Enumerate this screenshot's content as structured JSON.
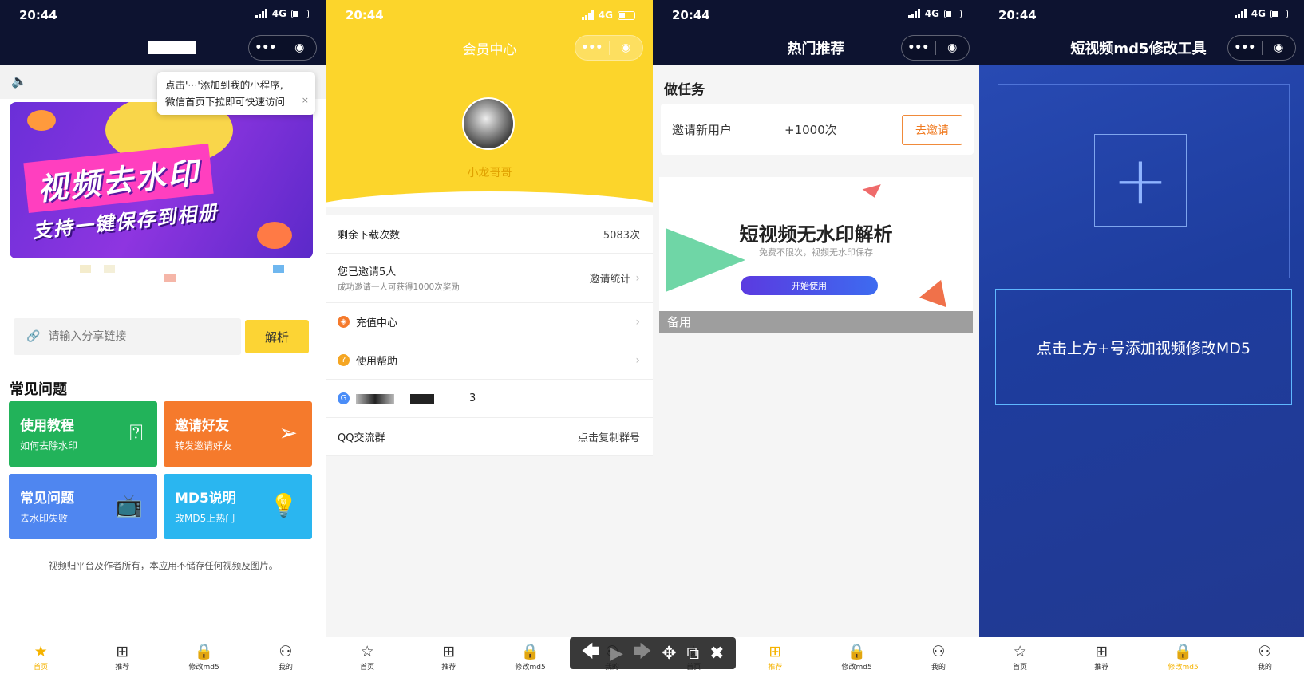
{
  "status": {
    "time": "20:44",
    "network": "4G"
  },
  "tabs": {
    "home": "首页",
    "recommend": "推荐",
    "modify": "修改md5",
    "mine": "我的"
  },
  "panel1": {
    "tooltip_line1": "点击'···'添加到我的小程序,",
    "tooltip_line2": "微信首页下拉即可快速访问",
    "tooltip_close": "×",
    "banner_title": "视频去水印",
    "banner_subtitle": "支持一键保存到相册",
    "input_placeholder": "请输入分享链接",
    "parse_button": "解析",
    "faq_title": "常见问题",
    "cards": [
      {
        "title": "使用教程",
        "subtitle": "如何去除水印",
        "icon": "question-chat-icon",
        "color": "#22b35a"
      },
      {
        "title": "邀请好友",
        "subtitle": "转发邀请好友",
        "icon": "paper-plane-icon",
        "color": "#f57a2c"
      },
      {
        "title": "常见问题",
        "subtitle": "去水印失败",
        "icon": "tv-icon",
        "color": "#4f86f0"
      },
      {
        "title": "MD5说明",
        "subtitle": "改MD5上热门",
        "icon": "lightbulb-icon",
        "color": "#2ab6f0"
      }
    ],
    "disclaimer": "视频归平台及作者所有，本应用不储存任何视频及图片。"
  },
  "panel2": {
    "title": "会员中心",
    "username": "小龙哥哥",
    "remaining_label": "剩余下载次数",
    "remaining_value": "5083次",
    "invited_label": "您已邀请5人",
    "invited_sub": "成功邀请一人可获得1000次奖励",
    "invite_stats": "邀请统计",
    "recharge": "充值中心",
    "help": "使用帮助",
    "group_count": "3",
    "qq_label": "QQ交流群",
    "qq_action": "点击复制群号"
  },
  "panel3": {
    "title": "热门推荐",
    "section": "做任务",
    "task_label": "邀请新用户",
    "task_reward": "+1000次",
    "task_button": "去邀请",
    "ad_title": "短视频无水印解析",
    "ad_subtitle": "免费不限次，视频无水印保存",
    "ad_button": "开始使用",
    "ad_footer": "备用"
  },
  "panel4": {
    "title": "短视频md5修改工具",
    "hint": "点击上方+号添加视频修改MD5",
    "plus": "+"
  },
  "capsule": {
    "more": "•••",
    "close": "◉"
  }
}
